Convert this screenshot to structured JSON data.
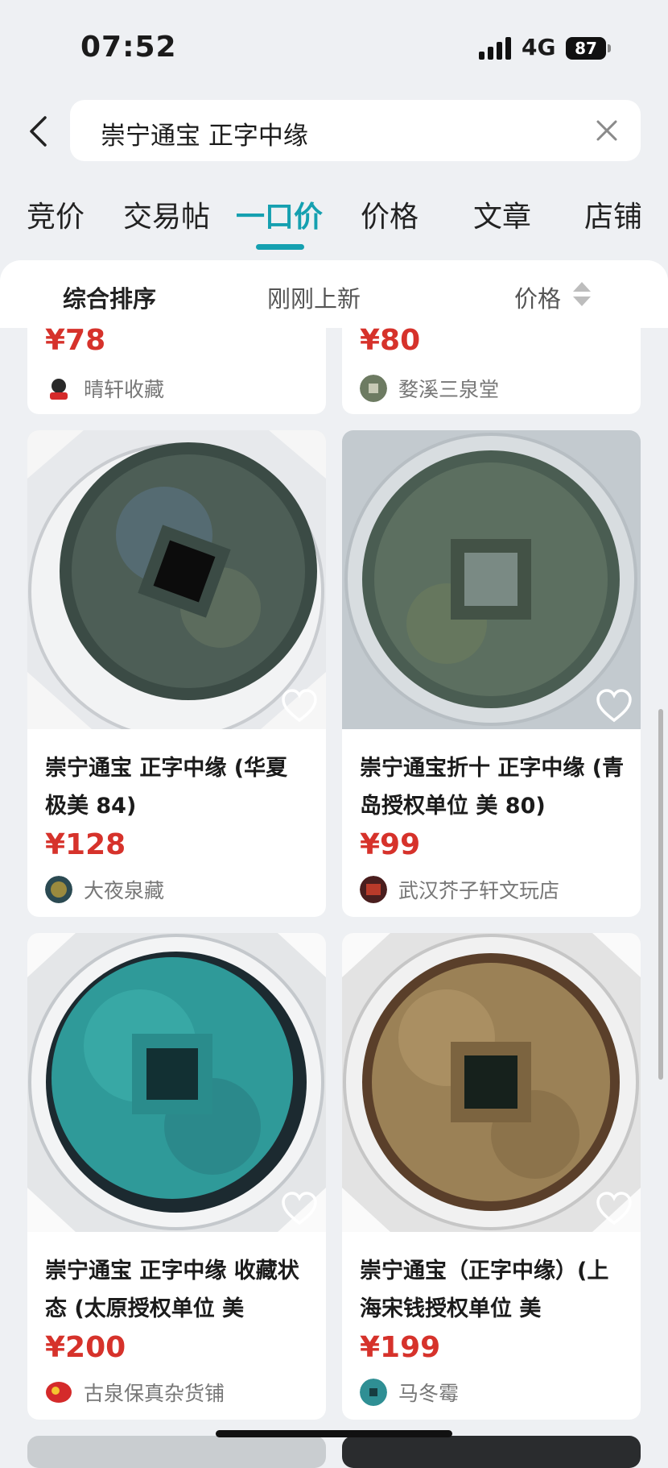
{
  "status_bar": {
    "time": "07:52",
    "network": "4G",
    "battery": "87"
  },
  "search": {
    "query": "崇宁通宝 正字中缘"
  },
  "tabs": [
    {
      "label": "竞价"
    },
    {
      "label": "交易帖"
    },
    {
      "label": "一口价"
    },
    {
      "label": "价格"
    },
    {
      "label": "文章"
    },
    {
      "label": "店铺"
    }
  ],
  "active_tab": "一口价",
  "sort_options": [
    {
      "label": "综合排序"
    },
    {
      "label": "刚刚上新"
    },
    {
      "label": "价格"
    }
  ],
  "top_partial_cards": [
    {
      "price": "¥78",
      "seller": "晴轩收藏"
    },
    {
      "price": "¥80",
      "seller": "婺溪三泉堂"
    }
  ],
  "listings": [
    {
      "title": "崇宁通宝 正字中缘 (华夏 极美 84)",
      "price": "¥128",
      "seller": "大夜泉藏"
    },
    {
      "title": "崇宁通宝折十 正字中缘 (青岛授权单位 美 80)",
      "price": "¥99",
      "seller": "武汉芥子轩文玩店"
    },
    {
      "title": "崇宁通宝 正字中缘 收藏状态 (太原授权单位 美",
      "price": "¥200",
      "seller": "古泉保真杂货铺"
    },
    {
      "title": "崇宁通宝（正字中缘）(上海宋钱授权单位 美",
      "price": "¥199",
      "seller": "马冬霉"
    }
  ],
  "colors": {
    "accent": "#15a0b0",
    "price": "#d6322b",
    "background": "#eef0f3"
  }
}
